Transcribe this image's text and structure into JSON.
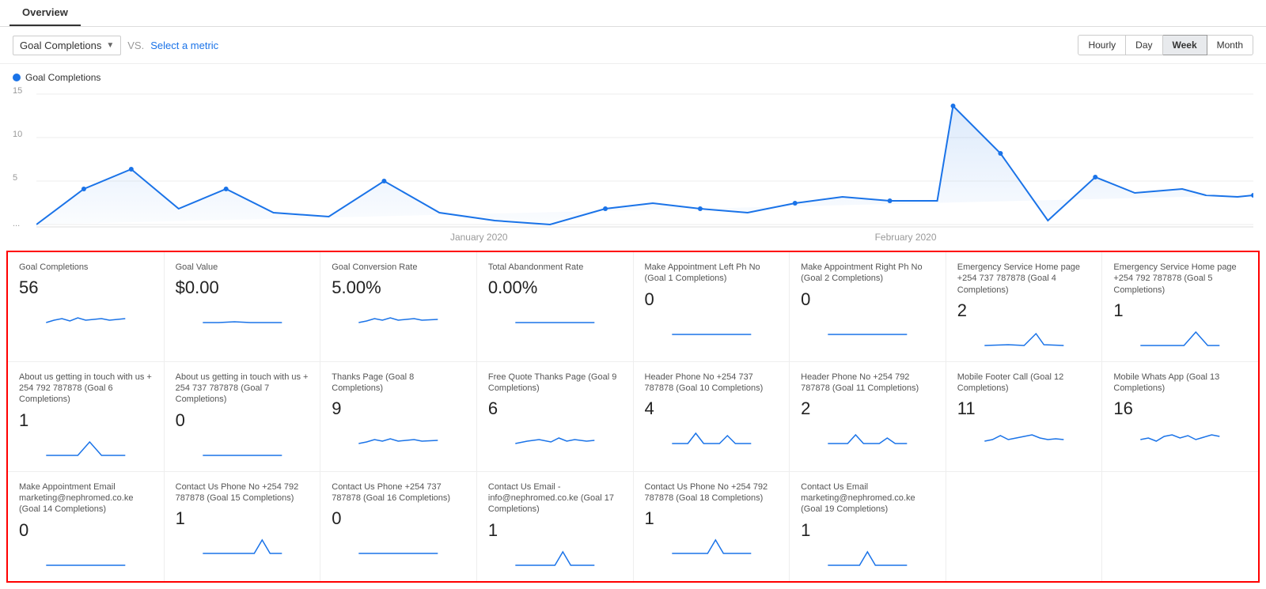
{
  "tabs": [
    {
      "label": "Overview",
      "active": true
    }
  ],
  "toolbar": {
    "metric_label": "Goal Completions",
    "vs_label": "VS.",
    "select_metric_label": "Select a metric",
    "time_buttons": [
      {
        "label": "Hourly",
        "active": false
      },
      {
        "label": "Day",
        "active": false
      },
      {
        "label": "Week",
        "active": true
      },
      {
        "label": "Month",
        "active": false
      }
    ]
  },
  "chart": {
    "legend_label": "Goal Completions",
    "y_labels": [
      "15",
      "10",
      "5",
      "..."
    ],
    "x_labels": [
      "January 2020",
      "February 2020"
    ]
  },
  "metrics_rows": [
    {
      "cards": [
        {
          "title": "Goal Completions",
          "value": "56",
          "sparkline": "flat_wave"
        },
        {
          "title": "Goal Value",
          "value": "$0.00",
          "sparkline": "flat_wave"
        },
        {
          "title": "Goal Conversion Rate",
          "value": "5.00%",
          "sparkline": "flat_wave"
        },
        {
          "title": "Total Abandonment Rate",
          "value": "0.00%",
          "sparkline": "flat_wave"
        },
        {
          "title": "Make Appointment Left Ph No (Goal 1 Completions)",
          "value": "0",
          "sparkline": "flat"
        },
        {
          "title": "Make Appointment Right Ph No (Goal 2 Completions)",
          "value": "0",
          "sparkline": "flat"
        },
        {
          "title": "Emergency Service Home page +254 737 787878 (Goal 4 Completions)",
          "value": "2",
          "sparkline": "flat_wave"
        },
        {
          "title": "Emergency Service Home page +254 792 787878 (Goal 5 Completions)",
          "value": "1",
          "sparkline": "spike"
        }
      ]
    },
    {
      "cards": [
        {
          "title": "About us getting in touch with us + 254 792 787878 (Goal 6 Completions)",
          "value": "1",
          "sparkline": "small_spike"
        },
        {
          "title": "About us getting in touch with us + 254 737 787878 (Goal 7 Completions)",
          "value": "0",
          "sparkline": "flat"
        },
        {
          "title": "Thanks Page (Goal 8 Completions)",
          "value": "9",
          "sparkline": "flat_wave"
        },
        {
          "title": "Free Quote Thanks Page (Goal 9 Completions)",
          "value": "6",
          "sparkline": "flat_wave"
        },
        {
          "title": "Header Phone No +254 737 787878 (Goal 10 Completions)",
          "value": "4",
          "sparkline": "bumps"
        },
        {
          "title": "Header Phone No +254 792 787878 (Goal 11 Completions)",
          "value": "2",
          "sparkline": "bumps"
        },
        {
          "title": "Mobile Footer Call (Goal 12 Completions)",
          "value": "11",
          "sparkline": "wave"
        },
        {
          "title": "Mobile Whats App (Goal 13 Completions)",
          "value": "16",
          "sparkline": "wave2"
        }
      ]
    },
    {
      "cards": [
        {
          "title": "Make Appointment Email marketing@nephromed.co.ke (Goal 14 Completions)",
          "value": "0",
          "sparkline": "flat"
        },
        {
          "title": "Contact Us Phone No +254 792 787878 (Goal 15 Completions)",
          "value": "1",
          "sparkline": "small_spike_right"
        },
        {
          "title": "Contact Us Phone +254 737 787878 (Goal 16 Completions)",
          "value": "0",
          "sparkline": "flat"
        },
        {
          "title": "Contact Us Email - info@nephromed.co.ke (Goal 17 Completions)",
          "value": "1",
          "sparkline": "small_spike_mid"
        },
        {
          "title": "Contact Us Phone No +254 792 787878 (Goal 18 Completions)",
          "value": "1",
          "sparkline": "small_spike"
        },
        {
          "title": "Contact Us Email marketing@nephromed.co.ke (Goal 19 Completions)",
          "value": "1",
          "sparkline": "small_spike"
        },
        {
          "title": "",
          "value": "",
          "sparkline": "empty"
        },
        {
          "title": "",
          "value": "",
          "sparkline": "empty"
        }
      ]
    }
  ]
}
